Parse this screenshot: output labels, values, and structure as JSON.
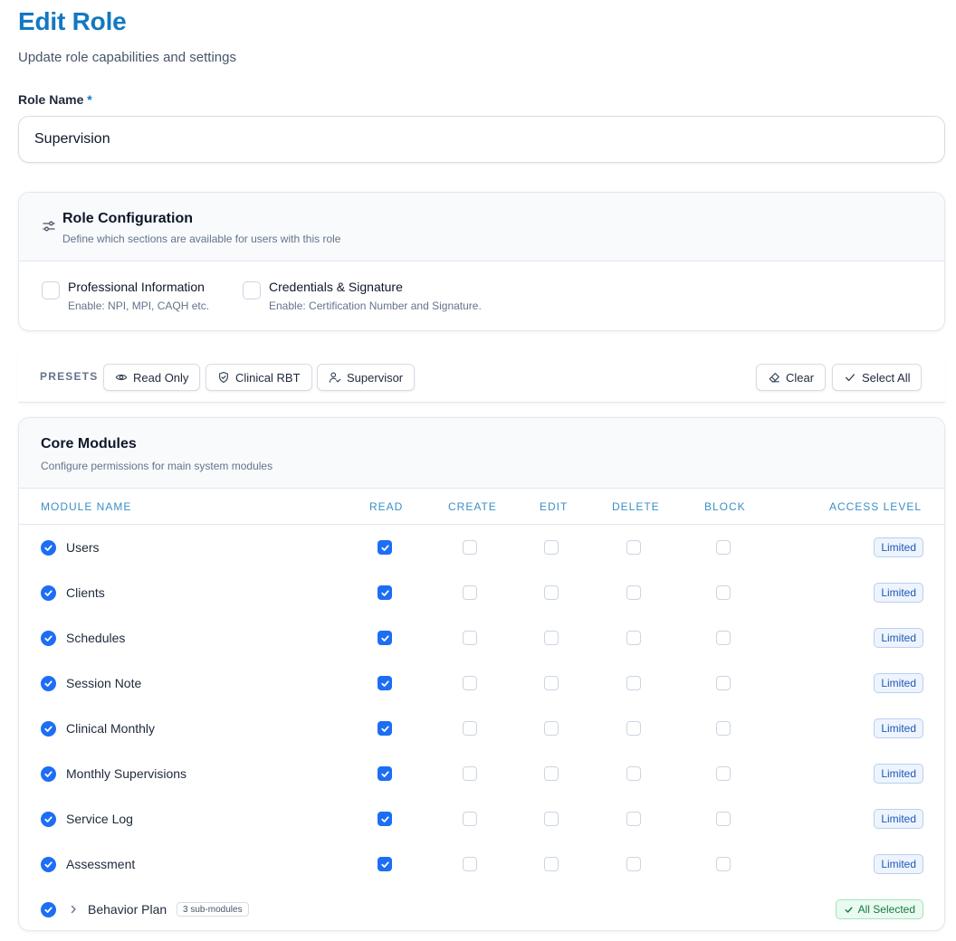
{
  "header": {
    "title": "Edit Role",
    "subtitle": "Update role capabilities and settings"
  },
  "role_name": {
    "label": "Role Name",
    "required_mark": "*",
    "value": "Supervision"
  },
  "role_configuration": {
    "title": "Role Configuration",
    "subtitle": "Define which sections are available for users with this role",
    "icon": "sliders-icon",
    "options": [
      {
        "label": "Professional Information",
        "description": "Enable: NPI, MPI, CAQH etc.",
        "checked": false
      },
      {
        "label": "Credentials & Signature",
        "description": "Enable: Certification Number and Signature.",
        "checked": false
      }
    ]
  },
  "presets": {
    "label": "PRESETS",
    "buttons": [
      {
        "label": "Read Only",
        "icon": "eye-icon"
      },
      {
        "label": "Clinical RBT",
        "icon": "shield-icon"
      },
      {
        "label": "Supervisor",
        "icon": "user-check-icon"
      }
    ],
    "clear_label": "Clear",
    "select_all_label": "Select All"
  },
  "core_modules": {
    "title": "Core Modules",
    "subtitle": "Configure permissions for main system modules",
    "columns": {
      "module_name": "MODULE NAME",
      "read": "READ",
      "create": "CREATE",
      "edit": "EDIT",
      "delete": "DELETE",
      "block": "BLOCK",
      "access_level": "ACCESS LEVEL"
    },
    "rows": [
      {
        "name": "Users",
        "enabled": true,
        "read": true,
        "create": false,
        "edit": false,
        "delete": false,
        "block": false,
        "access": "Limited"
      },
      {
        "name": "Clients",
        "enabled": true,
        "read": true,
        "create": false,
        "edit": false,
        "delete": false,
        "block": false,
        "access": "Limited"
      },
      {
        "name": "Schedules",
        "enabled": true,
        "read": true,
        "create": false,
        "edit": false,
        "delete": false,
        "block": false,
        "access": "Limited"
      },
      {
        "name": "Session Note",
        "enabled": true,
        "read": true,
        "create": false,
        "edit": false,
        "delete": false,
        "block": false,
        "access": "Limited"
      },
      {
        "name": "Clinical Monthly",
        "enabled": true,
        "read": true,
        "create": false,
        "edit": false,
        "delete": false,
        "block": false,
        "access": "Limited"
      },
      {
        "name": "Monthly Supervisions",
        "enabled": true,
        "read": true,
        "create": false,
        "edit": false,
        "delete": false,
        "block": false,
        "access": "Limited"
      },
      {
        "name": "Service Log",
        "enabled": true,
        "read": true,
        "create": false,
        "edit": false,
        "delete": false,
        "block": false,
        "access": "Limited"
      },
      {
        "name": "Assessment",
        "enabled": true,
        "read": true,
        "create": false,
        "edit": false,
        "delete": false,
        "block": false,
        "access": "Limited"
      }
    ],
    "group_row": {
      "name": "Behavior Plan",
      "enabled": true,
      "sub_label": "3 sub-modules",
      "access": "All Selected"
    }
  },
  "colors": {
    "accent": "#1378c0",
    "checkbox_blue": "#1d6ef5",
    "badge_blue_bg": "#eef4fd",
    "badge_green_bg": "#e9faf0"
  }
}
